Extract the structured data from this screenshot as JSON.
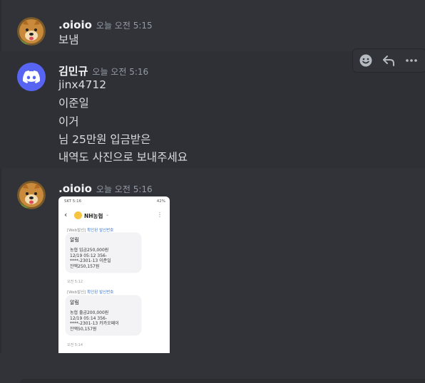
{
  "messages": [
    {
      "username": ".oioio",
      "timestamp": "오늘 오전 5:15",
      "lines": [
        "보냄"
      ]
    },
    {
      "username": "김민규",
      "timestamp": "오늘 오전 5:16",
      "lines": [
        "jinx4712",
        "이준일",
        "이거",
        "님 25만원 입금받은",
        "내역도 사진으로 보내주세요"
      ]
    },
    {
      "username": ".oioio",
      "timestamp": "오늘 오전 5:16",
      "attachment": {
        "status_left": "SKT 5:16",
        "status_right": "42%",
        "sender": "NH농협",
        "tag_prefix": "[Web발신]",
        "tag_link": "확인된 발신번호",
        "alerts": [
          {
            "title": "알림",
            "lines": [
              "농협 입금250,000원",
              "12/19 05:12 356-",
              "****-2301-13 이준일",
              "잔액250,157원"
            ],
            "time": "오전 5:12"
          },
          {
            "title": "알림",
            "lines": [
              "농협 출금200,000원",
              "12/19 05:14 356-",
              "****-2301-13 카카오페이",
              "잔액50,157원"
            ],
            "time": "오전 5:14"
          },
          {
            "title": "알림",
            "lines": [],
            "time": ""
          }
        ]
      }
    }
  ],
  "toolbar": {
    "icons": [
      "add-reaction-icon",
      "reply-icon",
      "more-icon"
    ]
  },
  "colors": {
    "background": "#313338",
    "username": "#f2f3f5",
    "timestamp": "#949ba4",
    "text": "#dbdee1",
    "discord_blurple": "#5865f2"
  }
}
